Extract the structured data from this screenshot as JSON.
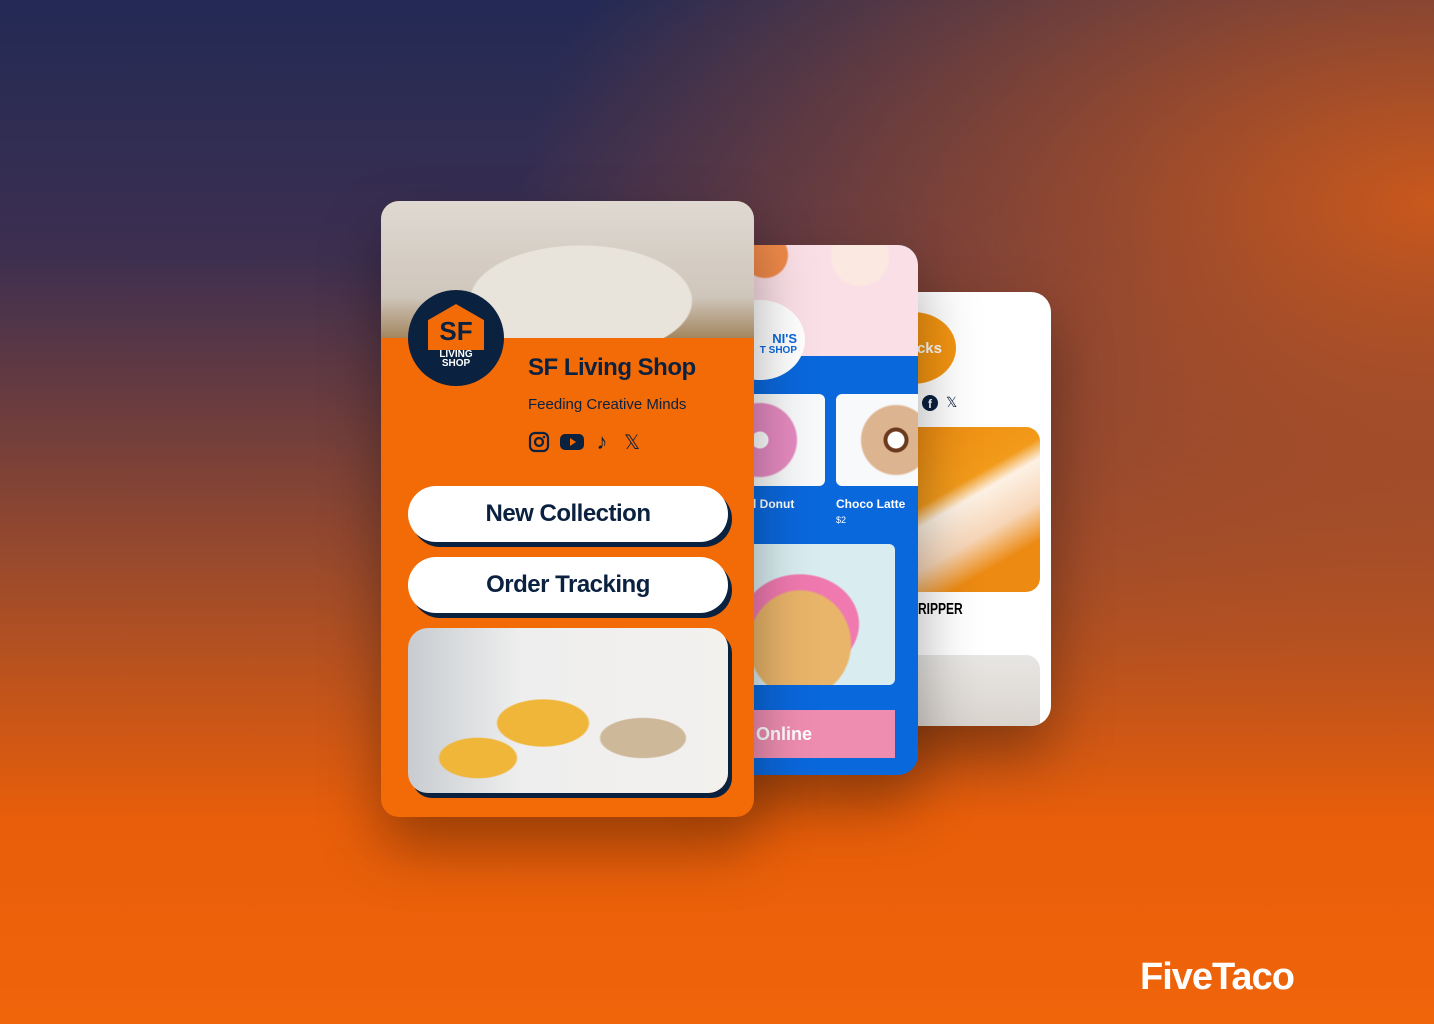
{
  "brand": "FiveTaco",
  "kicks": {
    "logo_text": "kicks",
    "product": "RIPPER",
    "social": [
      "facebook-icon",
      "x-icon"
    ]
  },
  "donut": {
    "logo_line1": "NI'S",
    "logo_line2": "T SHOP",
    "items": [
      {
        "name": "l Donut"
      },
      {
        "name": "Choco Latte",
        "price": "$2"
      }
    ],
    "button": "Online"
  },
  "front": {
    "logo_top": "SF",
    "logo_line1": "LIVING",
    "logo_line2": "SHOP",
    "title": "SF Living Shop",
    "tagline": "Feeding Creative Minds",
    "social": [
      "instagram-icon",
      "youtube-icon",
      "tiktok-icon",
      "x-icon"
    ],
    "buttons": [
      "New Collection",
      "Order Tracking"
    ]
  },
  "colors": {
    "orange": "#f26b06",
    "navy": "#0b2140",
    "blue": "#0a68dd",
    "pink": "#ef8db0"
  }
}
